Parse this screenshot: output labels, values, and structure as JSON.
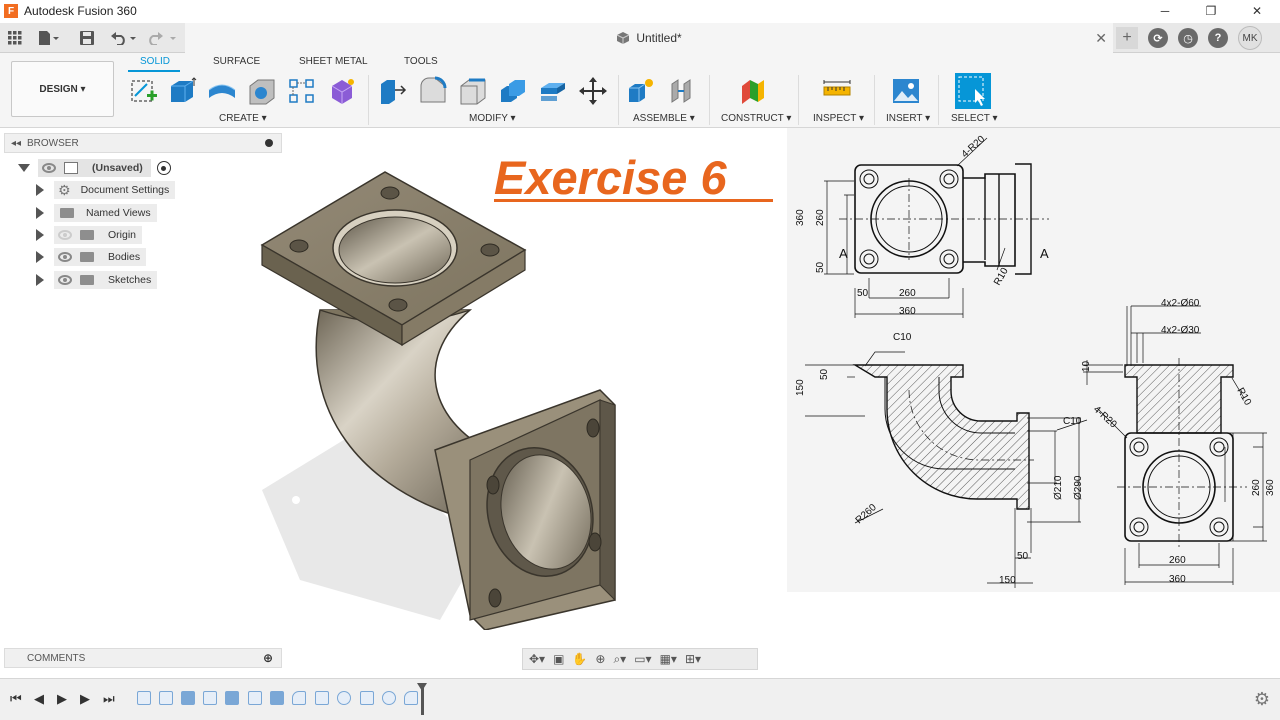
{
  "app": {
    "title": "Autodesk Fusion 360",
    "logo_letter": "F"
  },
  "window": {
    "minimize": "─",
    "maximize": "❐",
    "close": "✕"
  },
  "document": {
    "title": "Untitled*",
    "close": "✕"
  },
  "user": {
    "initials": "MK"
  },
  "workspace": {
    "label": "DESIGN ▾"
  },
  "tabs": [
    {
      "label": "SOLID",
      "active": true
    },
    {
      "label": "SURFACE",
      "active": false
    },
    {
      "label": "SHEET METAL",
      "active": false
    },
    {
      "label": "TOOLS",
      "active": false
    }
  ],
  "groups": {
    "create": "CREATE ▾",
    "modify": "MODIFY ▾",
    "assemble": "ASSEMBLE ▾",
    "construct": "CONSTRUCT ▾",
    "inspect": "INSPECT ▾",
    "insert": "INSERT ▾",
    "select": "SELECT ▾"
  },
  "browser": {
    "title": "BROWSER",
    "root": "(Unsaved)",
    "items": [
      "Document Settings",
      "Named Views",
      "Origin",
      "Bodies",
      "Sketches"
    ]
  },
  "comments": {
    "title": "COMMENTS"
  },
  "canvas": {
    "heading": "Exercise 6"
  },
  "drawing": {
    "dims": {
      "d4r20_top": "4-R20",
      "d360_left": "360",
      "d260_left": "260",
      "d50_left": "50",
      "section_a1": "A",
      "section_a2": "A",
      "d50_bot": "50",
      "d260_bot": "260",
      "d360_bot": "360",
      "r10_top": "R10",
      "c10_a": "C10",
      "d150_left": "150",
      "d50_sec": "50",
      "c10_b": "C10",
      "r260": "R260",
      "phi210": "Ø210",
      "phi290": "Ø290",
      "d50_sec_b": "50",
      "d150_bot": "150",
      "holes60": "4x2-Ø60",
      "holes30": "4x2-Ø30",
      "d10": "10",
      "r10_side": "R10",
      "d4r20_side": "4-R20",
      "d260_side": "260",
      "d360_side": "360",
      "d260_side_bot": "260",
      "d360_side_bot": "360"
    }
  },
  "colors": {
    "accent": "#0696d7",
    "heading": "#e8661e",
    "metal": "#8a8170"
  }
}
